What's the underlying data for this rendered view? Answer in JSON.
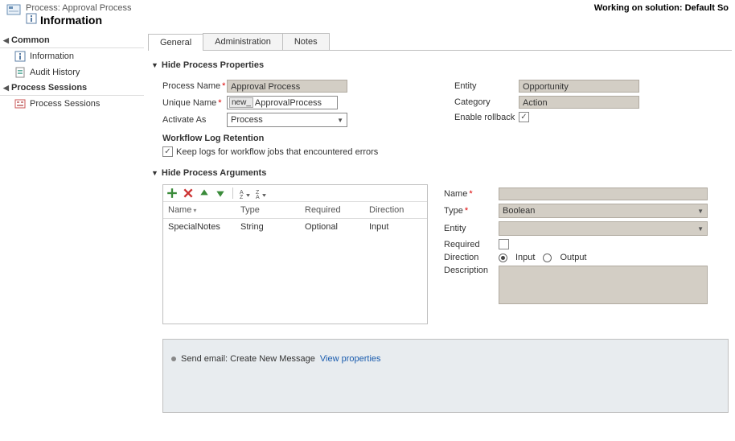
{
  "header": {
    "breadcrumb": "Process: Approval Process",
    "title": "Information",
    "working_on": "Working on solution: Default So"
  },
  "sidebar": {
    "groups": [
      {
        "title": "Common",
        "items": [
          {
            "label": "Information"
          },
          {
            "label": "Audit History"
          }
        ]
      },
      {
        "title": "Process Sessions",
        "items": [
          {
            "label": "Process Sessions"
          }
        ]
      }
    ]
  },
  "tabs": [
    "General",
    "Administration",
    "Notes"
  ],
  "properties": {
    "section_title": "Hide Process Properties",
    "process_name_label": "Process Name",
    "process_name_value": "Approval Process",
    "unique_name_label": "Unique Name",
    "unique_prefix": "new_",
    "unique_value": "ApprovalProcess",
    "activate_as_label": "Activate As",
    "activate_as_value": "Process",
    "entity_label": "Entity",
    "entity_value": "Opportunity",
    "category_label": "Category",
    "category_value": "Action",
    "enable_rollback_label": "Enable rollback",
    "log_header": "Workflow Log Retention",
    "log_checkbox_label": "Keep logs for workflow jobs that encountered errors"
  },
  "arguments": {
    "section_title": "Hide Process Arguments",
    "grid": {
      "headers": {
        "name": "Name",
        "type": "Type",
        "required": "Required",
        "direction": "Direction"
      },
      "rows": [
        {
          "name": "SpecialNotes",
          "type": "String",
          "required": "Optional",
          "direction": "Input"
        }
      ]
    },
    "form": {
      "name_label": "Name",
      "name_value": "",
      "type_label": "Type",
      "type_value": "Boolean",
      "entity_label": "Entity",
      "entity_value": "",
      "required_label": "Required",
      "direction_label": "Direction",
      "direction_input": "Input",
      "direction_output": "Output",
      "description_label": "Description"
    }
  },
  "steps": {
    "text": "Send email:  Create New Message",
    "link": "View properties"
  }
}
